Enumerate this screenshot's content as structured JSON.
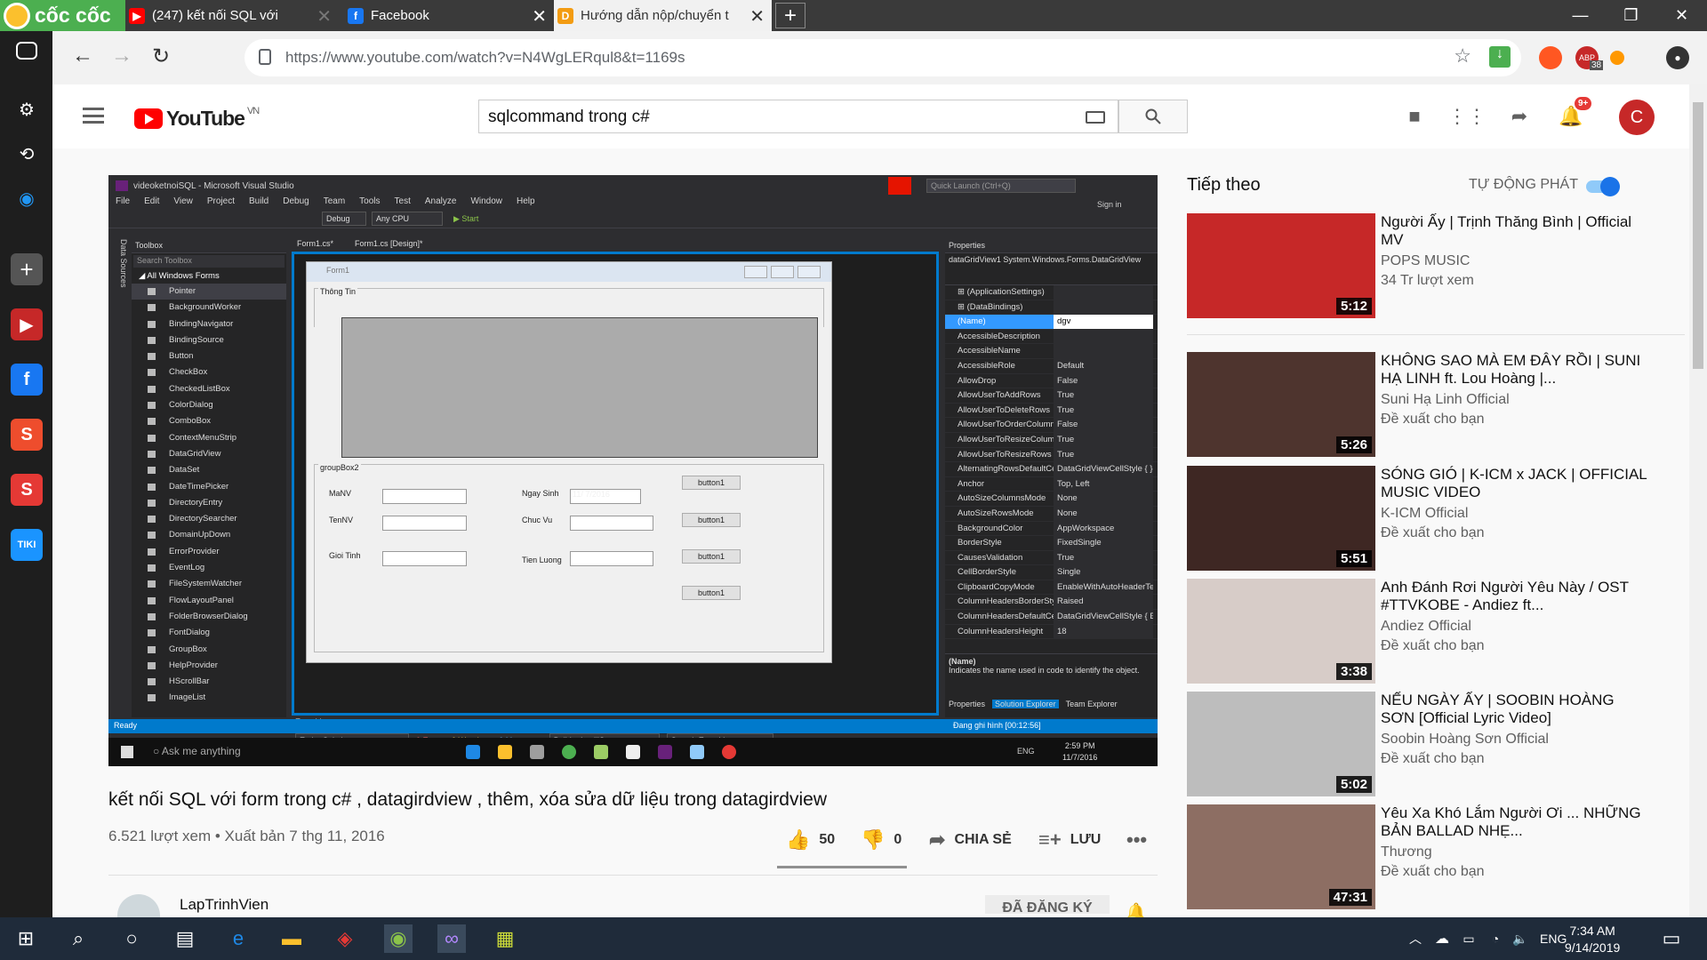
{
  "browser": {
    "brand": "cốc cốc",
    "tabs": [
      {
        "label": "(247) kết nối SQL với",
        "active": false
      },
      {
        "label": "Facebook",
        "active": false
      },
      {
        "label": "Hướng dẫn nộp/chuyển t",
        "active": true
      }
    ],
    "url": "https://www.youtube.com/watch?v=N4WgLERqul8&t=1169s",
    "ext_badge": "38"
  },
  "youtube": {
    "logo": "YouTube",
    "region": "VN",
    "search_value": "sqlcommand trong c#",
    "notif_count": "9+",
    "avatar_letter": "C"
  },
  "video": {
    "title": "kết nối SQL với form trong c# , datagirdview , thêm, xóa sửa dữ liệu trong datagirdview",
    "views": "6.521 lượt xem • Xuất bản 7 thg 11, 2016",
    "likes": "50",
    "dislikes": "0",
    "share": "CHIA SẺ",
    "save": "LƯU",
    "channel": "LapTrinhVien",
    "subscribe": "ĐÃ ĐĂNG KÝ"
  },
  "vs": {
    "window_title": "videoketnoiSQL - Microsoft Visual Studio",
    "quick_launch": "Quick Launch (Ctrl+Q)",
    "sign_in": "Sign in",
    "menu": [
      "File",
      "Edit",
      "View",
      "Project",
      "Build",
      "Debug",
      "Team",
      "Tools",
      "Test",
      "Analyze",
      "Window",
      "Help"
    ],
    "config": "Debug",
    "platform": "Any CPU",
    "start": "▶ Start",
    "toolbox_title": "Toolbox",
    "toolbox_search": "Search Toolbox",
    "toolbox_cat": "◢ All Windows Forms",
    "toolbox_items": [
      "Pointer",
      "BackgroundWorker",
      "BindingNavigator",
      "BindingSource",
      "Button",
      "CheckBox",
      "CheckedListBox",
      "ColorDialog",
      "ComboBox",
      "ContextMenuStrip",
      "DataGridView",
      "DataSet",
      "DateTimePicker",
      "DirectoryEntry",
      "DirectorySearcher",
      "DomainUpDown",
      "ErrorProvider",
      "EventLog",
      "FileSystemWatcher",
      "FlowLayoutPanel",
      "FolderBrowserDialog",
      "FontDialog",
      "GroupBox",
      "HelpProvider",
      "HScrollBar",
      "ImageList"
    ],
    "data_sources": "Data Sources",
    "doc_tabs": [
      "Form1.cs*",
      "Form1.cs [Design]*"
    ],
    "form_title": "Form1",
    "group1": "Thông Tin",
    "group2": "groupBox2",
    "labels": {
      "manv": "MaNV",
      "tennv": "TenNV",
      "gioitinh": "Gioi Tinh",
      "ngaysinh": "Ngay Sinh",
      "chucvu": "Chuc Vu",
      "tienluong": "Tien Luong"
    },
    "date_value": "11/ 7/2016",
    "buttons": [
      "button1",
      "button1",
      "button1",
      "button1"
    ],
    "props_title": "Properties",
    "props_object": "dataGridView1  System.Windows.Forms.DataGridView",
    "props": [
      {
        "k": "⊞ (ApplicationSettings)",
        "v": ""
      },
      {
        "k": "⊞ (DataBindings)",
        "v": ""
      },
      {
        "k": "(Name)",
        "v": "dgv"
      },
      {
        "k": "AccessibleDescription",
        "v": ""
      },
      {
        "k": "AccessibleName",
        "v": ""
      },
      {
        "k": "AccessibleRole",
        "v": "Default"
      },
      {
        "k": "AllowDrop",
        "v": "False"
      },
      {
        "k": "AllowUserToAddRows",
        "v": "True"
      },
      {
        "k": "AllowUserToDeleteRows",
        "v": "True"
      },
      {
        "k": "AllowUserToOrderColumns",
        "v": "False"
      },
      {
        "k": "AllowUserToResizeColumns",
        "v": "True"
      },
      {
        "k": "AllowUserToResizeRows",
        "v": "True"
      },
      {
        "k": "AlternatingRowsDefaultCellStyle",
        "v": "DataGridViewCellStyle { }"
      },
      {
        "k": "Anchor",
        "v": "Top, Left"
      },
      {
        "k": "AutoSizeColumnsMode",
        "v": "None"
      },
      {
        "k": "AutoSizeRowsMode",
        "v": "None"
      },
      {
        "k": "BackgroundColor",
        "v": "AppWorkspace"
      },
      {
        "k": "BorderStyle",
        "v": "FixedSingle"
      },
      {
        "k": "CausesValidation",
        "v": "True"
      },
      {
        "k": "CellBorderStyle",
        "v": "Single"
      },
      {
        "k": "ClipboardCopyMode",
        "v": "EnableWithAutoHeaderText"
      },
      {
        "k": "ColumnHeadersBorderStyle",
        "v": "Raised"
      },
      {
        "k": "ColumnHeadersDefaultCellStyle",
        "v": "DataGridViewCellStyle { BackC"
      },
      {
        "k": "ColumnHeadersHeight",
        "v": "18"
      }
    ],
    "prop_desc_title": "(Name)",
    "prop_desc": "Indicates the name used in code to identify the object.",
    "props_tabs": [
      "Properties",
      "Solution Explorer",
      "Team Explorer"
    ],
    "error_list": "Error List",
    "error_scope": "Entire Solution",
    "errors": "0 Errors",
    "warnings": "0 Warnings",
    "messages": "0 Messages",
    "build": "Build + IntelliSense",
    "search_errors": "Search Error List",
    "status": "Ready",
    "recording": "Đang ghi hình [00:12:56]",
    "cortana": "Ask me anything",
    "lang": "ENG",
    "time": "2:59 PM",
    "date": "11/7/2016"
  },
  "sidebar": {
    "up_next": "Tiếp theo",
    "autoplay": "TỰ ĐỘNG PHÁT",
    "items": [
      {
        "title": "Người Ấy | Trịnh Thăng Bình | Official MV",
        "channel": "POPS MUSIC",
        "meta": "34 Tr lượt xem",
        "duration": "5:12",
        "color": "#c62828"
      },
      {
        "title": "KHÔNG SAO MÀ EM ĐÂY RỒI | SUNI HẠ LINH ft. Lou Hoàng |...",
        "channel": "Suni Hạ Linh Official",
        "meta": "Đề xuất cho bạn",
        "duration": "5:26",
        "color": "#4e342e"
      },
      {
        "title": "SÓNG GIÓ | K-ICM x JACK | OFFICIAL MUSIC VIDEO",
        "channel": "K-ICM Official",
        "meta": "Đề xuất cho bạn",
        "duration": "5:51",
        "color": "#3e2723"
      },
      {
        "title": "Anh Đánh Rơi Người Yêu Này / OST #TTVKOBE - Andiez ft...",
        "channel": "Andiez Official",
        "meta": "Đề xuất cho bạn",
        "duration": "3:38",
        "color": "#d7ccc8"
      },
      {
        "title": "NẾU NGÀY ẤY | SOOBIN HOÀNG SƠN [Official Lyric Video]",
        "channel": "Soobin Hoàng Sơn Official",
        "meta": "Đề xuất cho bạn",
        "duration": "5:02",
        "color": "#bdbdbd"
      },
      {
        "title": "Yêu Xa Khó Lắm Người Ơi ... NHỮNG BẢN BALLAD NHẸ...",
        "channel": "Thương",
        "meta": "Đề xuất cho bạn",
        "duration": "47:31",
        "color": "#8d6e63"
      }
    ]
  },
  "taskbar": {
    "lang": "ENG",
    "time": "7:34 AM",
    "date": "9/14/2019"
  }
}
